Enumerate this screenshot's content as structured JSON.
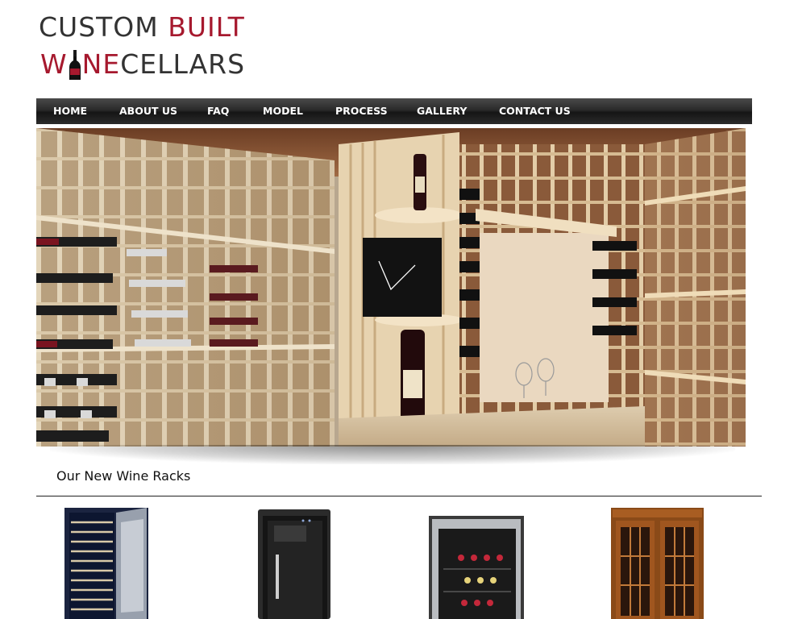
{
  "logo": {
    "line1_part1": "CUSTOM",
    "line1_part2": "BUILT",
    "line2_part1": "W",
    "line2_part2": "NE",
    "line2_part3": "CELLARS"
  },
  "nav": {
    "items": [
      {
        "label": "HOME"
      },
      {
        "label": "ABOUT US"
      },
      {
        "label": "FAQ"
      },
      {
        "label": "MODEL"
      },
      {
        "label": "PROCESS"
      },
      {
        "label": "GALLERY"
      },
      {
        "label": "CONTACT US"
      }
    ]
  },
  "section": {
    "title": "Our New Wine Racks"
  },
  "colors": {
    "brand_red": "#a6192e",
    "logo_gray": "#333333",
    "nav_dark": "#1f1f1f"
  }
}
